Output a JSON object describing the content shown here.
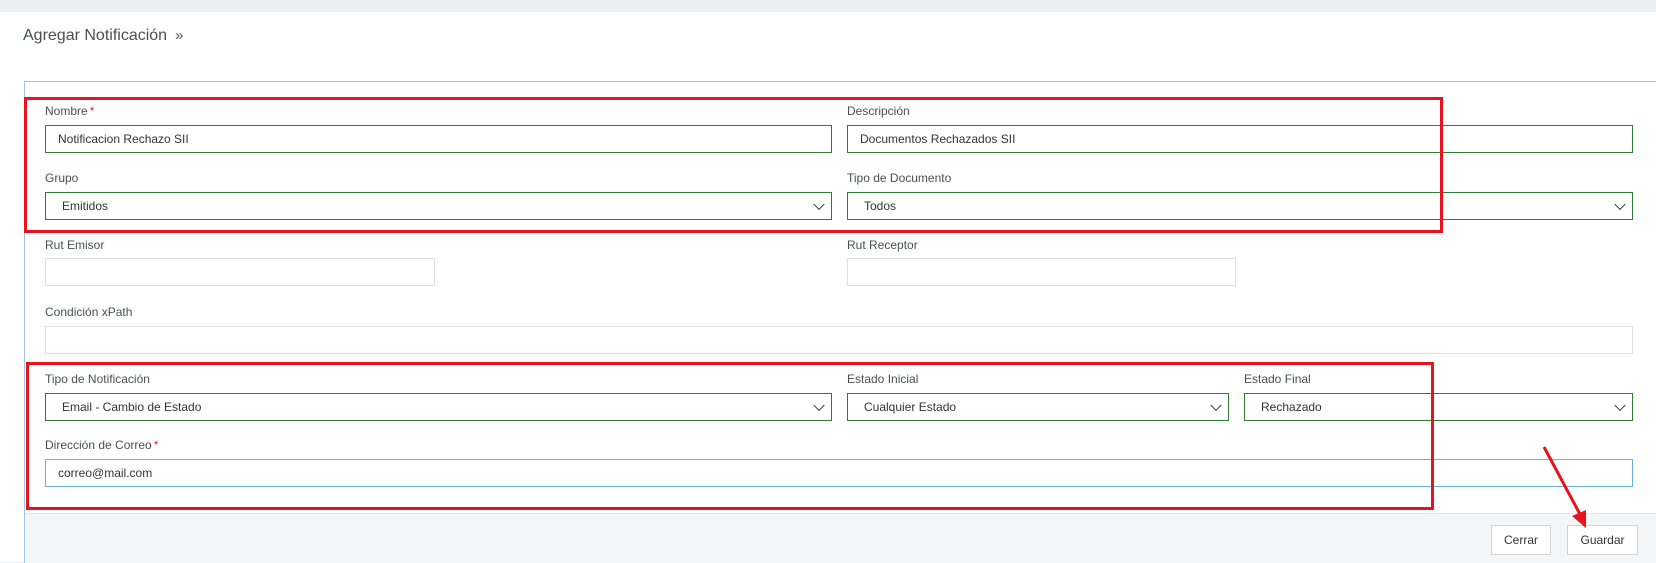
{
  "header": {
    "title": "Agregar Notificación",
    "chevron": "»"
  },
  "form": {
    "nombre": {
      "label": "Nombre",
      "required_mark": "*",
      "value": "Notificacion Rechazo SII"
    },
    "descripcion": {
      "label": "Descripción",
      "value": "Documentos Rechazados SII"
    },
    "grupo": {
      "label": "Grupo",
      "value": "Emitidos"
    },
    "tipo_documento": {
      "label": "Tipo de Documento",
      "value": "Todos"
    },
    "rut_emisor": {
      "label": "Rut Emisor",
      "value": ""
    },
    "rut_receptor": {
      "label": "Rut Receptor",
      "value": ""
    },
    "condicion_xpath": {
      "label": "Condición xPath",
      "value": ""
    },
    "tipo_notificacion": {
      "label": "Tipo de Notificación",
      "value": "Email - Cambio de Estado"
    },
    "estado_inicial": {
      "label": "Estado Inicial",
      "value": "Cualquier Estado"
    },
    "estado_final": {
      "label": "Estado Final",
      "value": "Rechazado"
    },
    "direccion_correo": {
      "label": "Dirección de Correo",
      "required_mark": "*",
      "value": "correo@mail.com"
    }
  },
  "footer": {
    "cerrar_label": "Cerrar",
    "guardar_label": "Guardar"
  },
  "annotations": {
    "highlight_color": "#e8141d"
  }
}
